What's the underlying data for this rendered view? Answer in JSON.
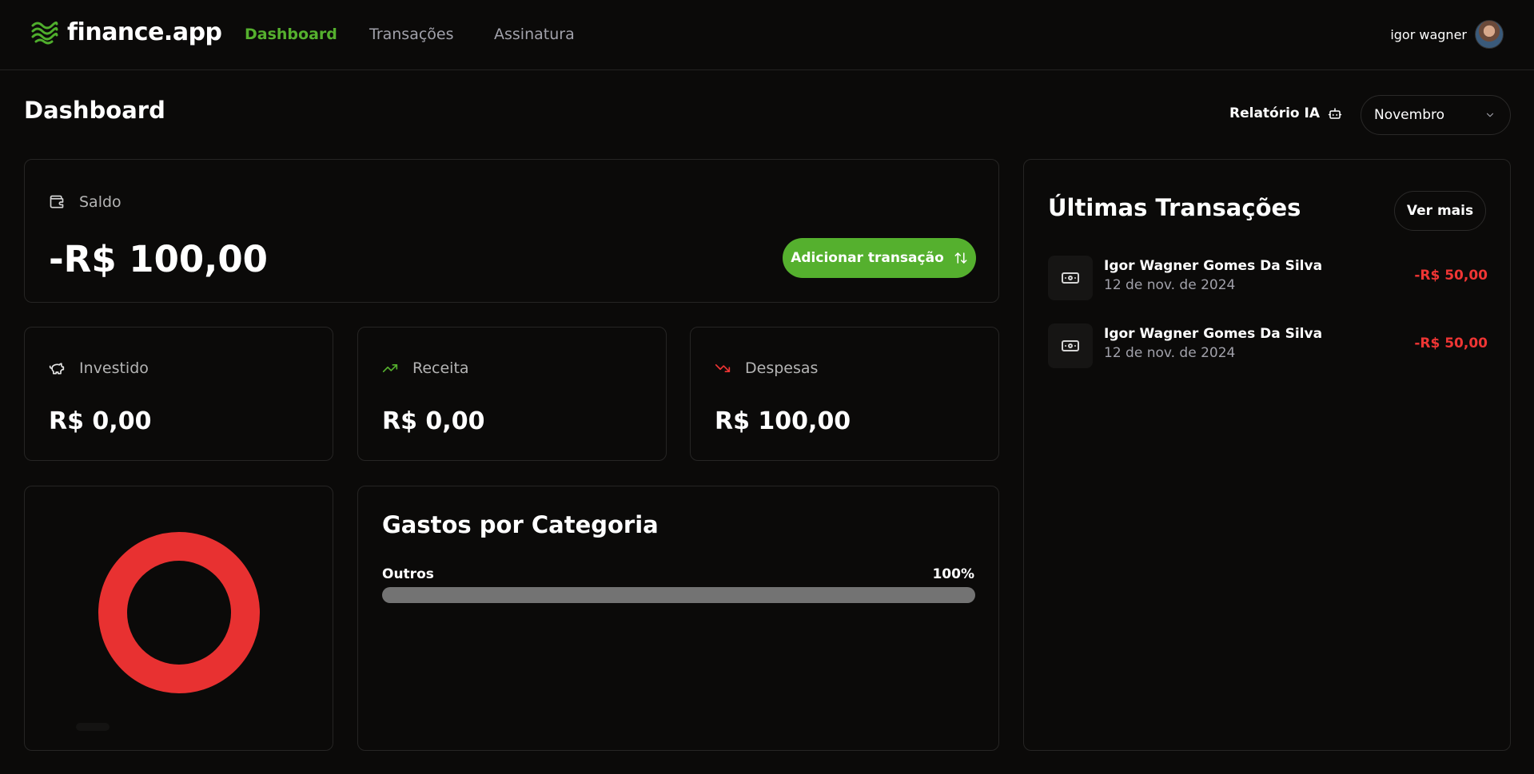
{
  "brand": {
    "name": "finance.app",
    "logo_icon": "waves-logo-icon",
    "accent_color": "#55b02e"
  },
  "nav": {
    "items": [
      {
        "label": "Dashboard",
        "active": true
      },
      {
        "label": "Transações",
        "active": false
      },
      {
        "label": "Assinatura",
        "active": false
      }
    ]
  },
  "user": {
    "name": "igor wagner",
    "avatar_icon": "user-avatar"
  },
  "page": {
    "title": "Dashboard"
  },
  "toolbar": {
    "ai_report_label": "Relatório IA",
    "ai_report_icon": "bot-icon",
    "month_selected": "Novembro",
    "month_icon": "chevron-down-icon"
  },
  "balance": {
    "label": "Saldo",
    "icon": "wallet-icon",
    "value": "-R$ 100,00",
    "add_button_label": "Adicionar transação",
    "add_button_icon": "arrows-up-down-icon"
  },
  "summary": [
    {
      "label": "Investido",
      "icon": "piggy-bank-icon",
      "value": "R$ 0,00",
      "color": "#ffffff"
    },
    {
      "label": "Receita",
      "icon": "trending-up-icon",
      "value": "R$ 0,00",
      "color": "#55b02e"
    },
    {
      "label": "Despesas",
      "icon": "trending-down-icon",
      "value": "R$ 100,00",
      "color": "#ef3534"
    }
  ],
  "chart_data": {
    "type": "pie",
    "categories": [
      "Despesas"
    ],
    "values": [
      100
    ],
    "colors": [
      "#e83131"
    ]
  },
  "categories": {
    "title": "Gastos por Categoria",
    "items": [
      {
        "label": "Outros",
        "percent_text": "100%",
        "percent": 100,
        "color": "#737373"
      }
    ]
  },
  "transactions": {
    "title": "Últimas Transações",
    "see_more_label": "Ver mais",
    "items": [
      {
        "name": "Igor Wagner Gomes Da Silva",
        "date": "12 de nov. de 2024",
        "amount": "-R$ 50,00",
        "icon": "cash-icon"
      },
      {
        "name": "Igor Wagner Gomes Da Silva",
        "date": "12 de nov. de 2024",
        "amount": "-R$ 50,00",
        "icon": "cash-icon"
      }
    ]
  }
}
